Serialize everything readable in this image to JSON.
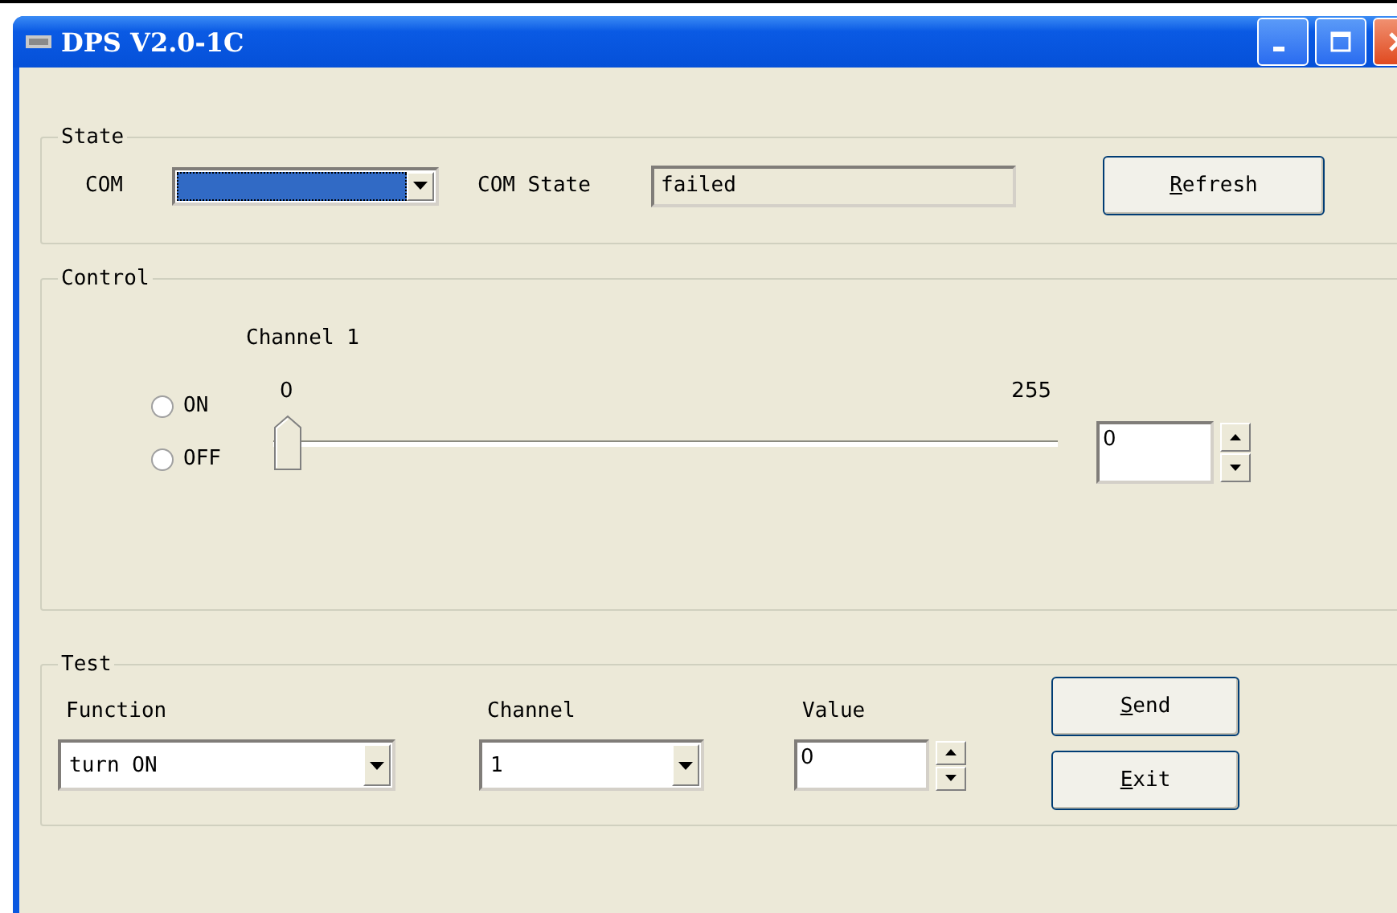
{
  "window": {
    "title": "DPS V2.0-1C"
  },
  "state": {
    "label": "State",
    "com_label": "COM",
    "com_state_label": "COM State",
    "com_state_value": "failed",
    "refresh_button": "Refresh"
  },
  "control": {
    "label": "Control",
    "channel_title": "Channel 1",
    "slider_min": "0",
    "slider_max": "255",
    "level": 0,
    "radios": [
      {
        "label": "ON",
        "selected": false
      },
      {
        "label": "OFF",
        "selected": false
      }
    ],
    "value": "0"
  },
  "test": {
    "label": "Test",
    "function_label": "Function",
    "function_value": "turn ON",
    "channel_label": "Channel",
    "channel_value": "1",
    "value_label": "Value",
    "value": "0",
    "send_button": "Send",
    "exit_button": "Exit"
  }
}
